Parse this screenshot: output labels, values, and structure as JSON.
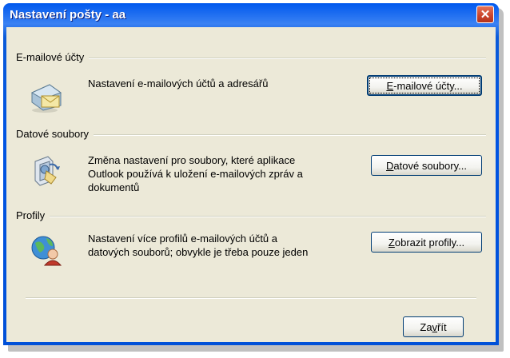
{
  "window": {
    "title": "Nastavení pošty - aa",
    "close_glyph": "✕"
  },
  "sections": {
    "accounts": {
      "label": "E-mailové účty",
      "description_lines": [
        "Nastavení e-mailových účtů a adresářů"
      ],
      "button_accel": "E",
      "button_rest": "-mailové účty...",
      "icon": "email-accounts-icon"
    },
    "datafiles": {
      "label": "Datové soubory",
      "description_lines": [
        "Změna nastavení pro soubory, které aplikace",
        "Outlook používá k uložení e-mailových zpráv a",
        "dokumentů"
      ],
      "button_accel": "D",
      "button_rest": "atové soubory...",
      "icon": "data-files-icon"
    },
    "profiles": {
      "label": "Profily",
      "description_lines": [
        "Nastavení více profilů e-mailových účtů a",
        "datových souborů; obvykle je třeba pouze jeden"
      ],
      "button_accel": "Z",
      "button_rest": "obrazit profily...",
      "icon": "profiles-icon"
    }
  },
  "footer": {
    "close_pre": "Za",
    "close_accel": "v",
    "close_post": "řít"
  },
  "colors": {
    "titlebar": "#0054e3",
    "client": "#ece9d8",
    "button_border": "#003c74",
    "close_button": "#c9432b"
  }
}
